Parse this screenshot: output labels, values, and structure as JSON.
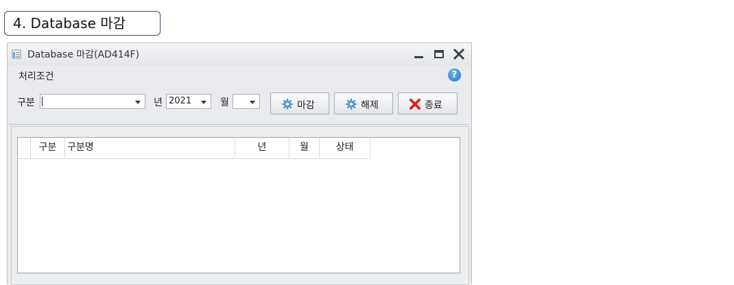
{
  "caption": "4. Database 마감",
  "window": {
    "title": "Database 마감(AD414F)",
    "controls": {
      "minimize": "minimize",
      "maximize": "maximize",
      "close": "close"
    }
  },
  "panel": {
    "title": "처리조건",
    "help_glyph": "?"
  },
  "filters": {
    "gubun_label": "구분",
    "gubun_value": "",
    "year_label": "년",
    "year_value": "2021",
    "month_label": "월",
    "month_value": ""
  },
  "buttons": {
    "close_period": "마감",
    "release": "해제",
    "exit": "종료"
  },
  "grid": {
    "columns": [
      "구분",
      "구분명",
      "년",
      "월",
      "상태"
    ],
    "rows": []
  },
  "colors": {
    "accent_blue": "#1f6fc6",
    "close_red": "#d8262b",
    "gear_blue": "#5b8fc7"
  },
  "icons": {
    "app": "database-form-icon",
    "help": "help-icon",
    "close_period": "gear-icon",
    "release": "gear-icon",
    "exit": "red-x-icon"
  }
}
